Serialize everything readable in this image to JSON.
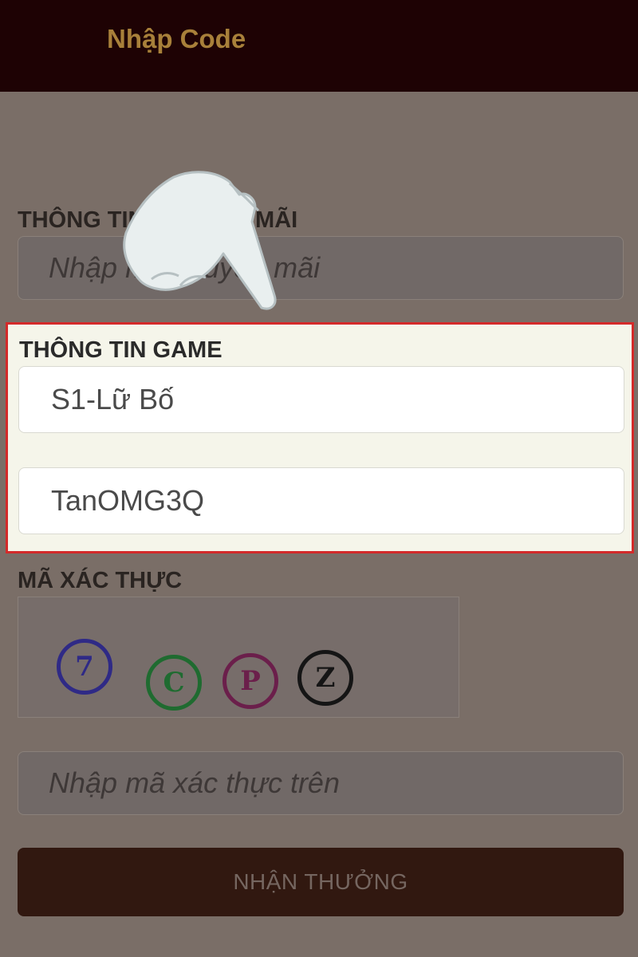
{
  "header": {
    "title": "Nhập Code"
  },
  "promo": {
    "label": "THÔNG TIN KHUYẾN MÃI",
    "placeholder": "Nhập mã khuyến mãi"
  },
  "game_info": {
    "label": "THÔNG TIN GAME",
    "server_value": "S1-Lữ Bố",
    "character_value": "TanOMG3Q"
  },
  "verification": {
    "label": "MÃ XÁC THỰC",
    "captcha_chars": [
      "7",
      "C",
      "P",
      "Z"
    ],
    "captcha_colors": [
      "#2f2a86",
      "#1f6b30",
      "#6b1f4b",
      "#151515"
    ],
    "placeholder": "Nhập mã xác thực trên"
  },
  "submit": {
    "label": "NHẬN THƯỞNG"
  },
  "colors": {
    "header_bg": "#1e0204",
    "title": "#a8803a",
    "overlay": "#7a6e67",
    "highlight_border": "#d42a2a",
    "button_bg": "#311810"
  },
  "overlay_icon": "pointing-hand-icon"
}
